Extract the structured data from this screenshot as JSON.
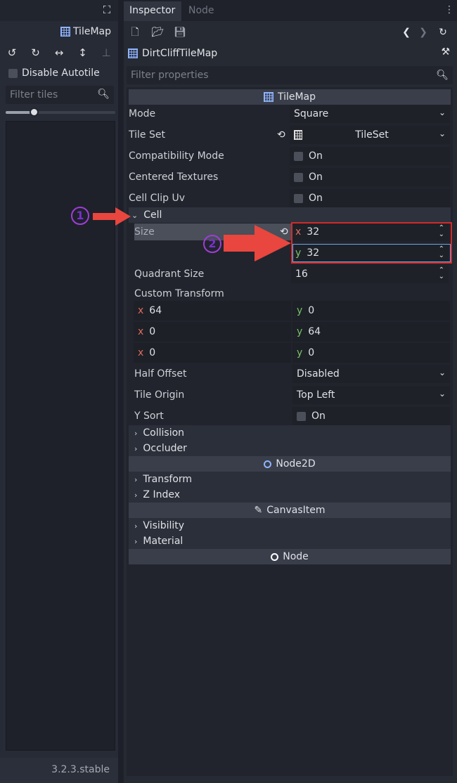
{
  "left_panel": {
    "title": "TileMap",
    "disable_autotile_label": "Disable Autotile",
    "filter_tiles_placeholder": "Filter tiles",
    "zoom_fraction": 0.26,
    "version": "3.2.3.stable"
  },
  "dock": {
    "tabs": [
      {
        "label": "Inspector",
        "active": true
      },
      {
        "label": "Node",
        "active": false
      }
    ],
    "object_name": "DirtCliffTileMap",
    "filter_placeholder": "Filter properties"
  },
  "inspector": {
    "tilemap_header": "TileMap",
    "mode_label": "Mode",
    "mode_value": "Square",
    "tileset_label": "Tile Set",
    "tileset_value": "TileSet",
    "compat_label": "Compatibility Mode",
    "centered_label": "Centered Textures",
    "clipuv_label": "Cell Clip Uv",
    "on_text": "On",
    "cell_header": "Cell",
    "size_label": "Size",
    "size_x": "32",
    "size_y": "32",
    "quadrant_label": "Quadrant Size",
    "quadrant_value": "16",
    "custom_transform_label": "Custom Transform",
    "transform": {
      "r1x": "64",
      "r1y": "0",
      "r2x": "0",
      "r2y": "64",
      "r3x": "0",
      "r3y": "0"
    },
    "axis_x": "x",
    "axis_y": "y",
    "half_offset_label": "Half Offset",
    "half_offset_value": "Disabled",
    "tile_origin_label": "Tile Origin",
    "tile_origin_value": "Top Left",
    "ysort_label": "Y Sort",
    "collision_label": "Collision",
    "occluder_label": "Occluder",
    "node2d_header": "Node2D",
    "transform_label": "Transform",
    "zindex_label": "Z Index",
    "canvasitem_header": "CanvasItem",
    "visibility_label": "Visibility",
    "material_label": "Material",
    "node_header": "Node"
  },
  "annotations": {
    "marker1": "1",
    "marker2": "2",
    "highlight_color": "#d22b2b",
    "arrow_color": "#e8463e"
  }
}
